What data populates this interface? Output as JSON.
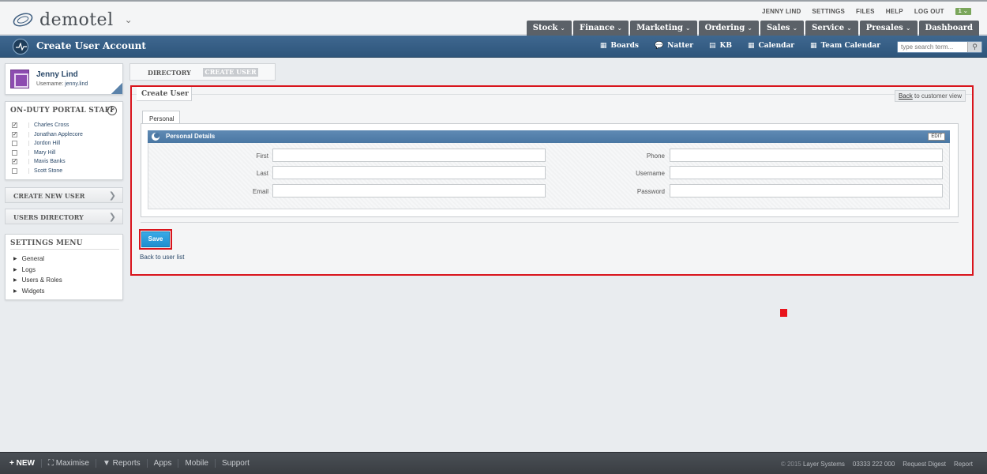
{
  "header": {
    "brand": "demotel",
    "toplinks": [
      "JENNY LIND",
      "SETTINGS",
      "FILES",
      "HELP",
      "LOG OUT"
    ],
    "notification_badge": "1",
    "nav": [
      {
        "label": "Stock"
      },
      {
        "label": "Finance"
      },
      {
        "label": "Marketing"
      },
      {
        "label": "Ordering"
      },
      {
        "label": "Sales"
      },
      {
        "label": "Service"
      },
      {
        "label": "Presales"
      },
      {
        "label": "Dashboard"
      }
    ]
  },
  "bluebar": {
    "title": "Create User Account",
    "quicklinks": [
      "Boards",
      "Natter",
      "KB",
      "Calendar",
      "Team Calendar"
    ],
    "search_placeholder": "type search term..."
  },
  "sidebar": {
    "user": {
      "name": "Jenny Lind",
      "username_label": "Username:",
      "username": "jenny.lind"
    },
    "staff_title": "ON-DUTY PORTAL STAFF",
    "staff": [
      {
        "name": "Charles Cross",
        "checked": true
      },
      {
        "name": "Jonathan Applecore",
        "checked": true
      },
      {
        "name": "Jordon Hill",
        "checked": false
      },
      {
        "name": "Mary Hill",
        "checked": false
      },
      {
        "name": "Mavis Banks",
        "checked": true
      },
      {
        "name": "Scott Stone",
        "checked": false
      }
    ],
    "create_new_user": "CREATE NEW USER",
    "users_directory": "USERS DIRECTORY",
    "settings_title": "SETTINGS MENU",
    "settings_items": [
      "General",
      "Logs",
      "Users & Roles",
      "Widgets"
    ]
  },
  "content": {
    "tabs": {
      "directory": "DIRECTORY",
      "create_user": "CREATE USER"
    },
    "panel_title": "Create User",
    "back_link_underlined": "Back",
    "back_link_rest": " to customer view",
    "personal_tab": "Personal",
    "section_title": "Personal Details",
    "edit_label": "EDIT",
    "fields_left": [
      {
        "label": "First",
        "value": ""
      },
      {
        "label": "Last",
        "value": ""
      },
      {
        "label": "Email",
        "value": ""
      }
    ],
    "fields_right": [
      {
        "label": "Phone",
        "value": ""
      },
      {
        "label": "Username",
        "value": ""
      },
      {
        "label": "Password",
        "value": ""
      }
    ],
    "save_label": "Save",
    "back_to_list": "Back to user list"
  },
  "footer": {
    "new_label": "+ NEW",
    "items": [
      "Maximise",
      "Reports",
      "Apps",
      "Mobile",
      "Support"
    ],
    "copyright": "© 2015",
    "right_items": [
      "Layer Systems",
      "03333 222 000",
      "Request Digest",
      "Report"
    ]
  },
  "colors": {
    "accent_blue": "#2e557b",
    "highlight_red": "#d9141c",
    "save_blue": "#1e8fd0"
  }
}
